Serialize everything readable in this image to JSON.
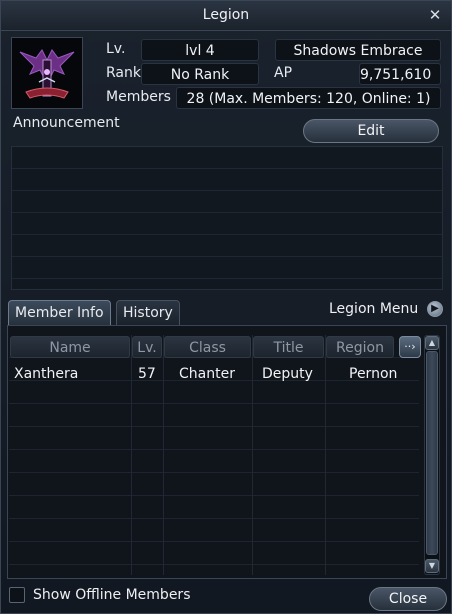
{
  "window": {
    "title": "Legion"
  },
  "info": {
    "lv_label": "Lv.",
    "level": "lvl 4",
    "legion_name": "Shadows Embrace",
    "rank_label": "Rank",
    "rank": "No Rank",
    "ap_label": "AP",
    "ap": "9,751,610",
    "members_label": "Members",
    "members": "28 (Max. Members: 120, Online: 1)"
  },
  "announcement": {
    "label": "Announcement",
    "edit_label": "Edit"
  },
  "tabs": [
    {
      "label": "Member Info",
      "active": true
    },
    {
      "label": "History",
      "active": false
    }
  ],
  "legion_menu": {
    "label": "Legion Menu"
  },
  "table": {
    "columns": [
      "Name",
      "Lv.",
      "Class",
      "Title",
      "Region"
    ],
    "rows": [
      {
        "name": "Xanthera",
        "lv": "57",
        "class": "Chanter",
        "title": "Deputy",
        "region": "Pernon"
      }
    ]
  },
  "footer": {
    "show_offline_label": "Show Offline Members",
    "show_offline_checked": false,
    "close_label": "Close"
  },
  "icons": {
    "close": "close-icon",
    "emblem": "legion-emblem",
    "menu_arrow": "arrow-right-circle-icon",
    "columns_more": "more-columns-icon",
    "scroll_up": "scroll-up-icon",
    "scroll_down": "scroll-down-icon"
  },
  "colors": {
    "accent": "#6b7b8e",
    "background": "#121821",
    "text": "#e6e9ee"
  }
}
